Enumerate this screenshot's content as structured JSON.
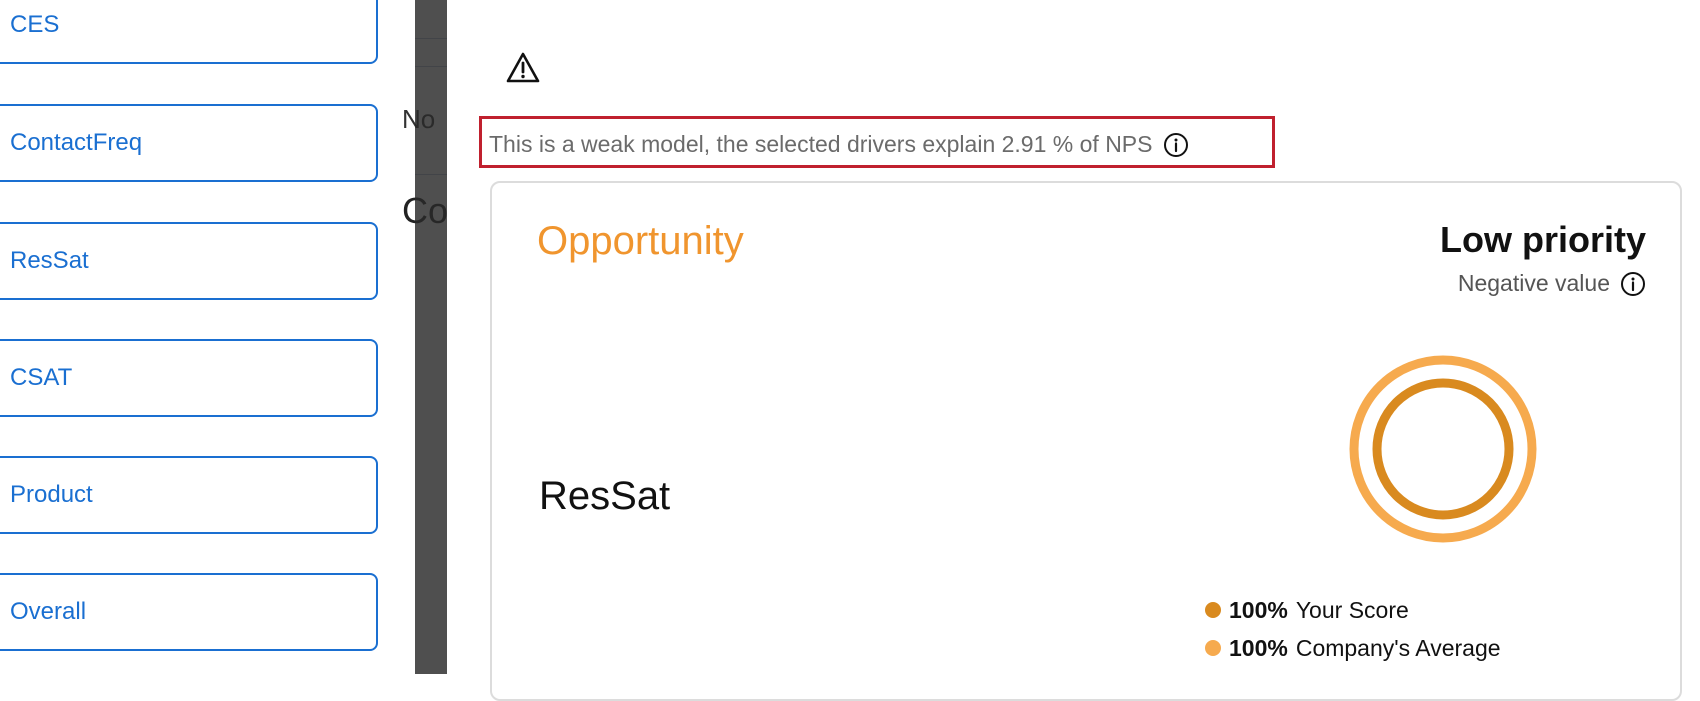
{
  "drivers": [
    {
      "label": "CES"
    },
    {
      "label": "ContactFreq"
    },
    {
      "label": "ResSat"
    },
    {
      "label": "CSAT"
    },
    {
      "label": "Product"
    },
    {
      "label": "Overall"
    }
  ],
  "background": {
    "fragment_1": "No",
    "fragment_2": "Co"
  },
  "modal": {
    "warning_text": "This is a weak model, the selected drivers explain 2.91 % of NPS",
    "card": {
      "title": "Opportunity",
      "priority": "Low priority",
      "value_note": "Negative value",
      "driver": "ResSat",
      "legend": [
        {
          "value": "100%",
          "label": "Your Score",
          "color": "#d98a1f"
        },
        {
          "value": "100%",
          "label": "Company's Average",
          "color": "#f6aa4e"
        }
      ]
    }
  },
  "colors": {
    "accent_blue": "#1a6fd1",
    "opportunity_orange": "#f0952e",
    "highlight_red": "#c0202e",
    "score_ring": "#d98a1f",
    "average_ring": "#f6aa4e"
  },
  "icons": [
    "warning-icon",
    "info-icon"
  ],
  "chart": {
    "your_score_percent": 100,
    "company_average_percent": 100
  }
}
